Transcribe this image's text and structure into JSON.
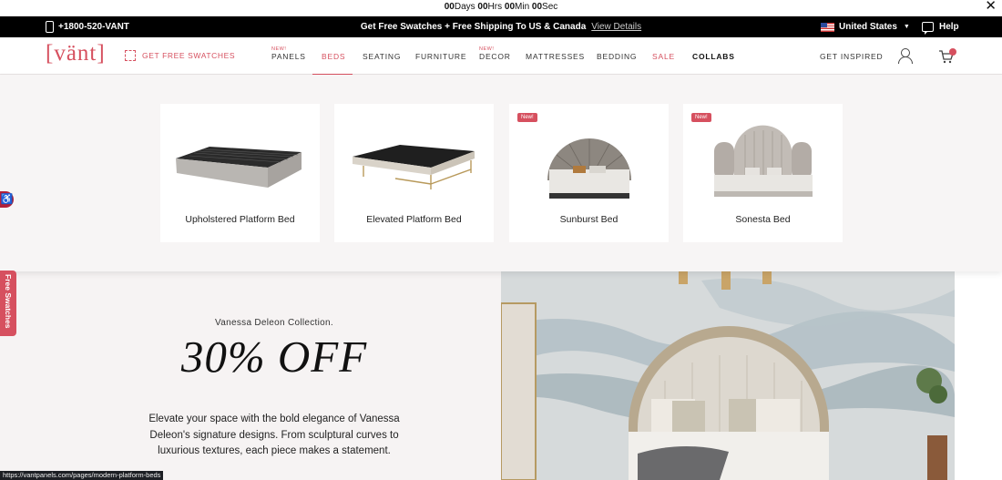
{
  "countdown": {
    "days": "00",
    "days_label": "Days",
    "hrs": "00",
    "hrs_label": "Hrs",
    "min": "00",
    "min_label": "Min",
    "sec": "00",
    "sec_label": "Sec"
  },
  "promo": {
    "phone": "+1800-520-VANT",
    "message": "Get Free Swatches + Free Shipping To US & Canada",
    "details_link": "View Details",
    "country": "United States",
    "help": "Help"
  },
  "nav": {
    "logo": "[vänt]",
    "swatches": "GET FREE SWATCHES",
    "new_label": "NEW!",
    "items": [
      {
        "label": "PANELS"
      },
      {
        "label": "BEDS"
      },
      {
        "label": "SEATING"
      },
      {
        "label": "FURNITURE"
      },
      {
        "label": "DECOR"
      },
      {
        "label": "MATTRESSES"
      },
      {
        "label": "BEDDING"
      },
      {
        "label": "SALE"
      },
      {
        "label": "COLLABS"
      }
    ],
    "inspired": "GET INSPIRED"
  },
  "dropdown": {
    "badge": "New!",
    "cards": [
      {
        "name": "Upholstered Platform Bed"
      },
      {
        "name": "Elevated Platform Bed"
      },
      {
        "name": "Sunburst Bed"
      },
      {
        "name": "Sonesta Bed"
      }
    ]
  },
  "hero": {
    "subtitle": "Vanessa Deleon Collection.",
    "headline": "30% OFF",
    "description": "Elevate your space with the bold elegance of Vanessa Deleon's signature designs. From sculptural curves to luxurious textures, each piece makes a statement."
  },
  "side_tab": "Free Swatches",
  "status_url": "https://vantpanels.com/pages/modern-platform-beds",
  "colors": {
    "accent": "#d6505f",
    "bar": "#000000",
    "page_bg": "#f6f3f3"
  }
}
